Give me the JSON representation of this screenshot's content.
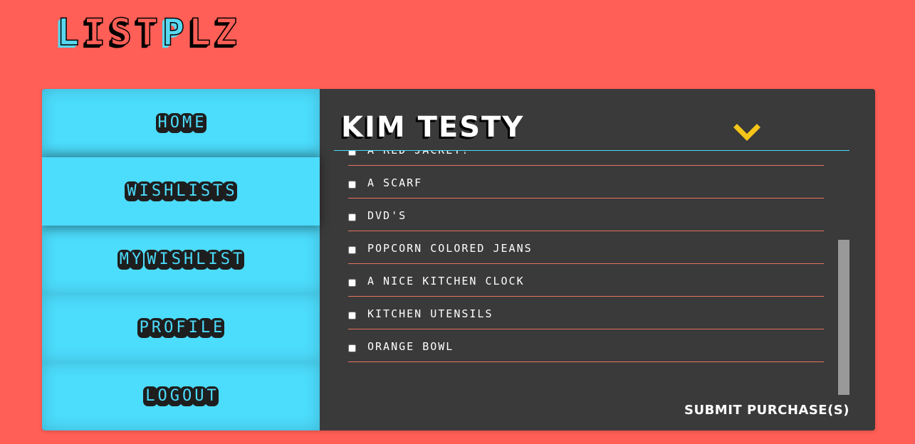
{
  "app": {
    "logo": [
      "L",
      "I",
      "S",
      "T",
      "P",
      "L",
      "Z"
    ],
    "logo_accent_letters": [
      0,
      4
    ],
    "colors": {
      "background": "#ff5f56",
      "sidebar": "#4cdcfc",
      "content": "#3a3a3a",
      "accent": "#f5c518",
      "divider": "#e8735e"
    }
  },
  "sidebar": {
    "items": [
      {
        "label": "Home"
      },
      {
        "label": "Wishlists"
      },
      {
        "label": "My Wishlist"
      },
      {
        "label": "Profile"
      },
      {
        "label": "Logout"
      }
    ],
    "active_index": 1
  },
  "list": {
    "title": "Kim Testy",
    "toggle_icon": "chevron-down-icon",
    "items": [
      {
        "label": "A red jacket!",
        "checked": false
      },
      {
        "label": "A scarf",
        "checked": false
      },
      {
        "label": "DVD's",
        "checked": false
      },
      {
        "label": "Popcorn colored jeans",
        "checked": false
      },
      {
        "label": "A nice kitchen clock",
        "checked": false
      },
      {
        "label": "Kitchen utensils",
        "checked": false
      },
      {
        "label": "Orange bowl",
        "checked": false
      }
    ],
    "submit_label": "Submit purchase(s)"
  }
}
